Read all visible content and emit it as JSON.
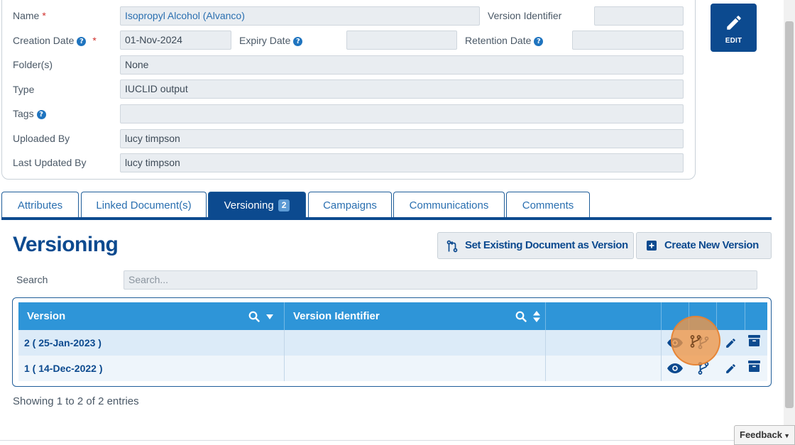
{
  "details": {
    "name_label": "Name",
    "name_value": "Isopropyl Alcohol (Alvanco)",
    "version_identifier_label": "Version Identifier",
    "version_identifier_value": "",
    "creation_date_label": "Creation Date",
    "creation_date_value": "01-Nov-2024",
    "expiry_date_label": "Expiry Date",
    "expiry_date_value": "",
    "retention_date_label": "Retention Date",
    "retention_date_value": "",
    "folders_label": "Folder(s)",
    "folders_value": "None",
    "type_label": "Type",
    "type_value": "IUCLID output",
    "tags_label": "Tags",
    "tags_value": "",
    "uploaded_by_label": "Uploaded By",
    "uploaded_by_value": "lucy timpson",
    "last_updated_by_label": "Last Updated By",
    "last_updated_by_value": "lucy timpson",
    "required_marker": "*",
    "help_marker": "?"
  },
  "edit_button": {
    "label": "EDIT",
    "icon": "pencil-icon"
  },
  "tabs": [
    {
      "label": "Attributes",
      "active": false
    },
    {
      "label": "Linked Document(s)",
      "active": false
    },
    {
      "label": "Versioning",
      "active": true,
      "badge": "2"
    },
    {
      "label": "Campaigns",
      "active": false
    },
    {
      "label": "Communications",
      "active": false
    },
    {
      "label": "Comments",
      "active": false
    }
  ],
  "versioning": {
    "title": "Versioning",
    "set_existing_label": "Set Existing Document as Version",
    "create_new_label": "Create New Version",
    "search_label": "Search",
    "search_placeholder": "Search...",
    "columns": [
      "Version",
      "Version Identifier"
    ],
    "rows": [
      {
        "version": "2 ( 25-Jan-2023 )",
        "identifier": ""
      },
      {
        "version": "1 ( 14-Dec-2022 )",
        "identifier": ""
      }
    ],
    "row_actions": [
      "eye-icon",
      "branch-icon",
      "pencil-icon",
      "archive-icon"
    ],
    "footer": "Showing 1 to 2 of 2 entries"
  },
  "feedback": {
    "label": "Feedback"
  },
  "colors": {
    "primary": "#0c4a8f",
    "header": "#2e95d8",
    "highlight": "#f0964690"
  }
}
